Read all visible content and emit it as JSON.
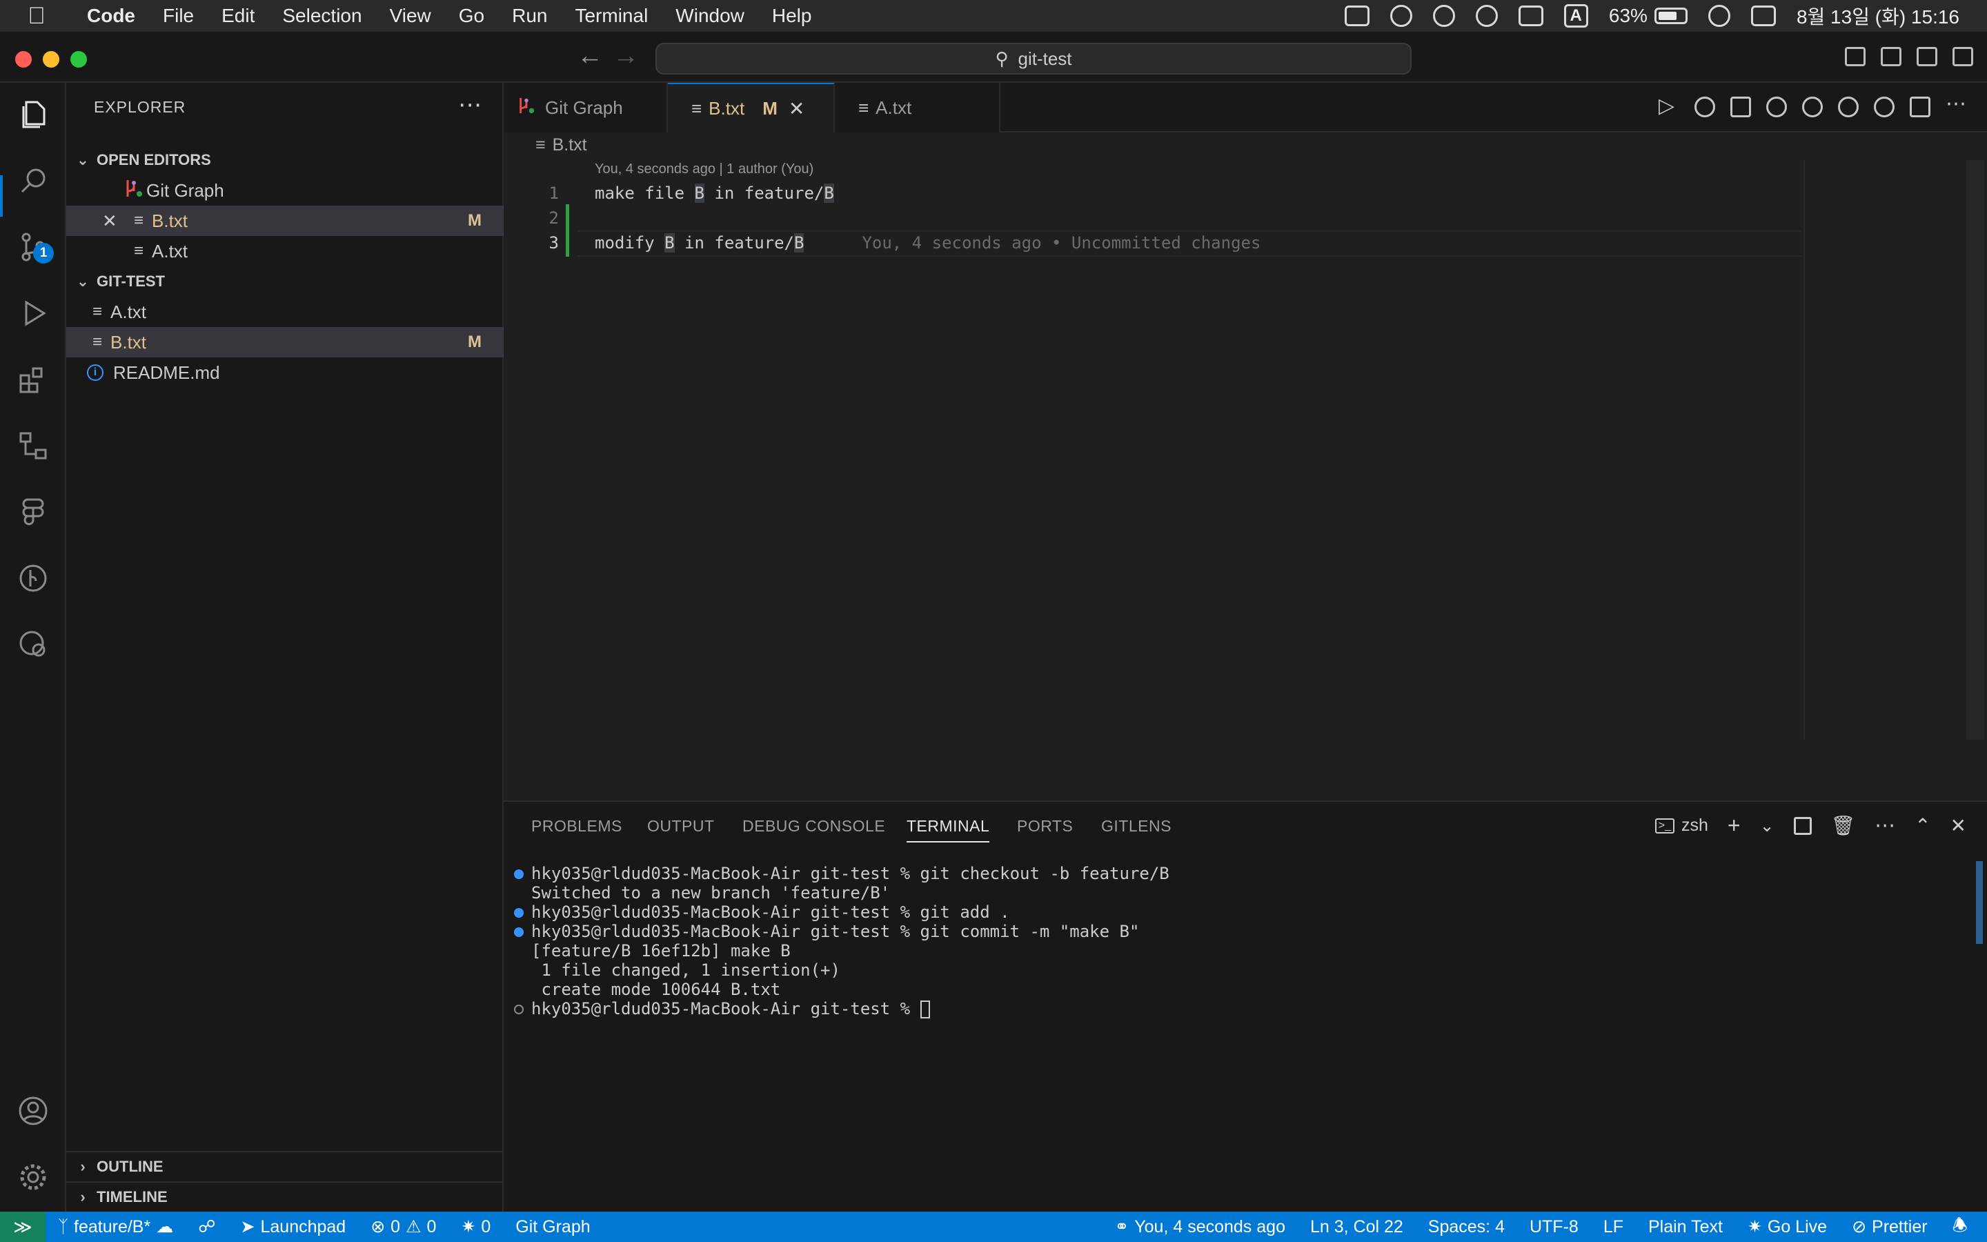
{
  "menubar": {
    "app": "Code",
    "items": [
      "File",
      "Edit",
      "Selection",
      "View",
      "Go",
      "Run",
      "Terminal",
      "Window",
      "Help"
    ],
    "ime": "A",
    "battery": "63%",
    "datetime": "8월 13일 (화) 15:16"
  },
  "titlebar": {
    "search": "git-test"
  },
  "sidebar": {
    "header": "EXPLORER",
    "open_editors": {
      "title": "OPEN EDITORS",
      "items": [
        {
          "label": "Git Graph"
        },
        {
          "label": "B.txt",
          "badge": "M"
        },
        {
          "label": "A.txt"
        }
      ]
    },
    "workspace": {
      "title": "GIT-TEST",
      "items": [
        {
          "label": "A.txt"
        },
        {
          "label": "B.txt",
          "badge": "M"
        },
        {
          "label": "README.md"
        }
      ]
    },
    "outline": "OUTLINE",
    "timeline": "TIMELINE",
    "scm_badge": "1"
  },
  "tabs": [
    {
      "label": "Git Graph"
    },
    {
      "label": "B.txt",
      "badge": "M"
    },
    {
      "label": "A.txt"
    }
  ],
  "editor": {
    "breadcrumb": "B.txt",
    "codelens": "You, 4 seconds ago | 1 author (You)",
    "lines": [
      {
        "num": "1",
        "pre": "make file ",
        "hl1": "B",
        "mid": " in feature/",
        "hl2": "B"
      },
      {
        "num": "2"
      },
      {
        "num": "3",
        "pre": "modify ",
        "hl1": "B",
        "mid": " in feature/",
        "hl2": "B",
        "blame": "You, 4 seconds ago • Uncommitted changes"
      }
    ]
  },
  "panel": {
    "tabs": [
      "PROBLEMS",
      "OUTPUT",
      "DEBUG CONSOLE",
      "TERMINAL",
      "PORTS",
      "GITLENS"
    ],
    "shell": "zsh",
    "terminal": [
      "hky035@rldud035-MacBook-Air git-test % git checkout -b feature/B",
      "Switched to a new branch 'feature/B'",
      "hky035@rldud035-MacBook-Air git-test % git add .",
      "hky035@rldud035-MacBook-Air git-test % git commit -m \"make B\"",
      "[feature/B 16ef12b] make B",
      " 1 file changed, 1 insertion(+)",
      " create mode 100644 B.txt",
      "hky035@rldud035-MacBook-Air git-test % "
    ]
  },
  "statusbar": {
    "branch": "feature/B*",
    "launchpad": "Launchpad",
    "errors": "0",
    "warnings": "0",
    "ports": "0",
    "git_graph": "Git Graph",
    "blame": "You, 4 seconds ago",
    "position": "Ln 3, Col 22",
    "spaces": "Spaces: 4",
    "encoding": "UTF-8",
    "eol": "LF",
    "language": "Plain Text",
    "golive": "Go Live",
    "prettier": "Prettier"
  },
  "colors": {
    "accent": "#0078d4",
    "modified": "#e2c08d",
    "added": "#2ea043"
  }
}
